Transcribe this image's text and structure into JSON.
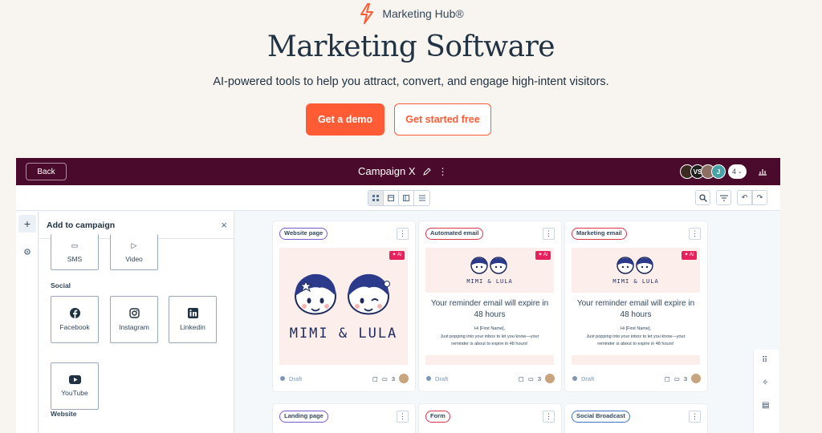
{
  "hero": {
    "brand": "Marketing Hub®",
    "title": "Marketing Software",
    "subtitle": "AI-powered tools to help you attract, convert, and engage high-intent visitors.",
    "cta_primary": "Get a demo",
    "cta_secondary": "Get started free"
  },
  "app": {
    "back_label": "Back",
    "campaign_title": "Campaign X",
    "collaborators": [
      "",
      "VS",
      "",
      "J"
    ],
    "collaborator_count": "4",
    "panel": {
      "title": "Add to campaign",
      "top_items": [
        "SMS",
        "Video"
      ],
      "social_label": "Social",
      "social_items": [
        "Facebook",
        "Instagram",
        "Linkedin",
        "YouTube"
      ],
      "website_label": "Website"
    },
    "cards": [
      {
        "type": "Website page",
        "status": "Draft",
        "count": "3",
        "brand": "MIMI & LULA"
      },
      {
        "type": "Automated email",
        "status": "Draft",
        "count": "3",
        "brand": "MIMI & LULA",
        "headline": "Your reminder email will expire in 48 hours",
        "greeting": "Hi [First Name],",
        "text": "Just popping into your inbox to let you know—your reminder is about to expire in 48 hours!"
      },
      {
        "type": "Marketing email",
        "status": "Draft",
        "count": "3",
        "brand": "MIMI & LULA",
        "headline": "Your reminder email will expire in 48 hours",
        "greeting": "Hi [First Name],",
        "text": "Just popping into your inbox to let you know—your reminder is about to expire in 48 hours!"
      }
    ],
    "bottom_cards": [
      "Landing page",
      "Form",
      "Social Broadcast"
    ],
    "ai_badge": "✦ AI",
    "more": "⋮",
    "colors": {
      "accent": "#ff5c35",
      "topbar": "#4a0a2b",
      "website": "#7b5ccc",
      "email": "#d9364b",
      "social": "#3f74c4"
    }
  }
}
